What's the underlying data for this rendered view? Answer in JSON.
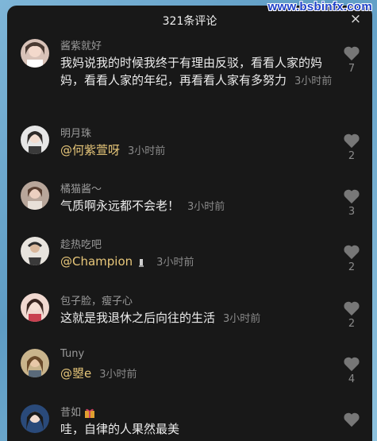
{
  "watermark": "www.bsbinfx.com",
  "header": {
    "title": "321条评论",
    "close_glyph": "×"
  },
  "comments": [
    {
      "name": "酱紫就好",
      "mention": "",
      "text": "我妈说我的时候我终于有理由反驳，看看人家的妈妈，看看人家的年纪，再看看人家有多努力",
      "time": "3小时前",
      "likes": "7"
    },
    {
      "name": "明月珠",
      "mention": "@何紫萱呀",
      "text": "",
      "time": "3小时前",
      "likes": "2"
    },
    {
      "name": "橘猫酱～",
      "mention": "",
      "text": "气质啊永远都不会老！",
      "time": "3小时前",
      "likes": "3"
    },
    {
      "name": "趁热吃吧",
      "mention": "@Champion",
      "text": "",
      "time": "3小时前",
      "likes": "2"
    },
    {
      "name": "包子脸，瘦子心",
      "mention": "",
      "text": "这就是我退休之后向往的生活",
      "time": "3小时前",
      "likes": "2"
    },
    {
      "name": "Tuny",
      "mention": "@曌e",
      "text": "",
      "time": "3小时前",
      "likes": "4"
    },
    {
      "name": "昔如",
      "mention": "",
      "text": "哇，自律的人果然最美",
      "time": "",
      "likes": ""
    }
  ],
  "colors": {
    "panel": "#181818",
    "mention": "#e8c77a",
    "muted": "#8a8a8a"
  },
  "icons": {
    "like": "heart-icon",
    "close": "close-icon"
  }
}
